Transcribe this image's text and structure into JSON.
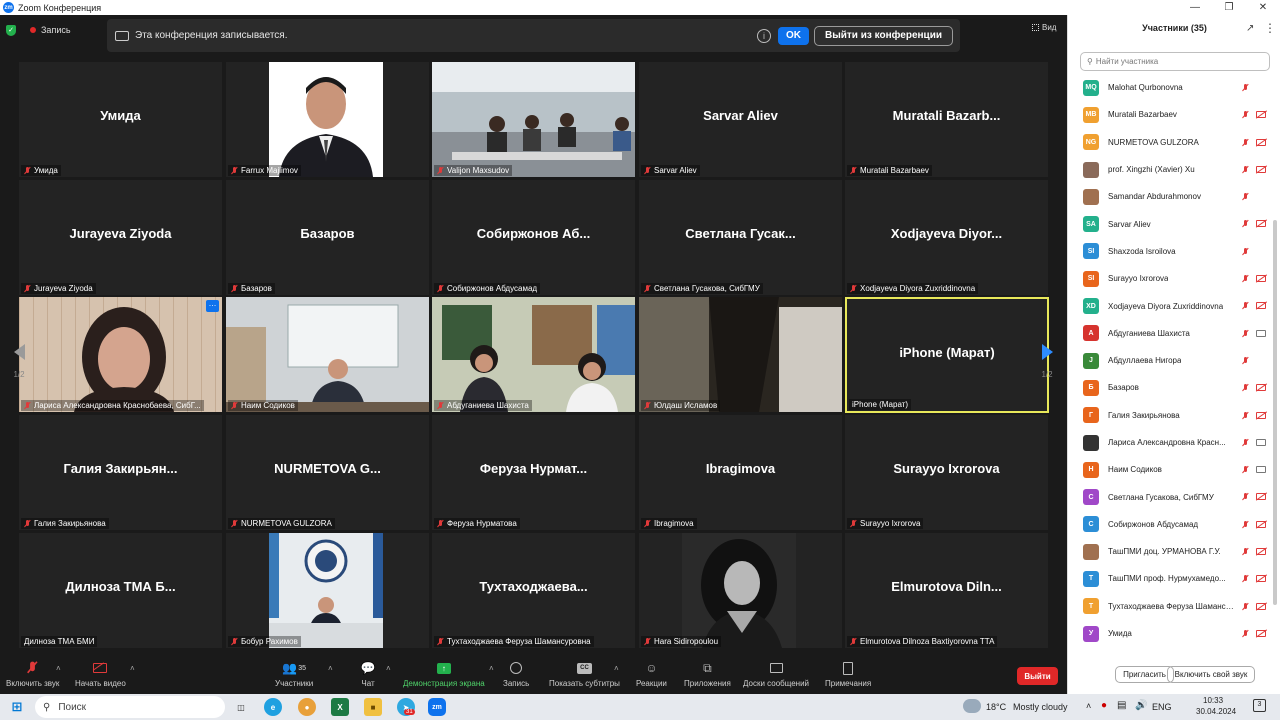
{
  "window": {
    "title": "Zoom Конференция"
  },
  "recording": {
    "label": "Запись"
  },
  "banner": {
    "text": "Эта конференция записывается.",
    "ok_label": "OK",
    "leave_label": "Выйти из конференции"
  },
  "view_label": "Вид",
  "page_indicator": "1/2",
  "tiles": [
    {
      "name": "Умида",
      "label": "Умида"
    },
    {
      "name": "",
      "label": "Farrux Majlimov"
    },
    {
      "name": "",
      "label": "Valijon Maxsudov"
    },
    {
      "name": "Sarvar Aliev",
      "label": "Sarvar Aliev"
    },
    {
      "name": "Muratali Bazarb...",
      "label": "Muratali Bazarbaev"
    },
    {
      "name": "Jurayeva Ziyoda",
      "label": "Jurayeva Ziyoda"
    },
    {
      "name": "Базаров",
      "label": "Базаров"
    },
    {
      "name": "Собиржонов Аб...",
      "label": "Собиржонов Абдусамад"
    },
    {
      "name": "Светлана Гусак...",
      "label": "Светлана Гусакова, СибГМУ"
    },
    {
      "name": "Xodjayeva Diyor...",
      "label": "Xodjayeva Diyora Zuxriddinovna"
    },
    {
      "name": "",
      "label": "Лариса Александровна Краснобаева, СибГ..."
    },
    {
      "name": "",
      "label": "Наим Содиков"
    },
    {
      "name": "",
      "label": "Абдуганиева Шахиста"
    },
    {
      "name": "",
      "label": "Юлдаш Исламов"
    },
    {
      "name": "iPhone (Марат)",
      "label": "iPhone (Марат)"
    },
    {
      "name": "Галия Закирьян...",
      "label": "Галия Закирьянова"
    },
    {
      "name": "NURMETOVA G...",
      "label": "NURMETOVA GULZORA"
    },
    {
      "name": "Феруза Нурмат...",
      "label": "Феруза Нурматова"
    },
    {
      "name": "Ibragimova",
      "label": "Ibragimova"
    },
    {
      "name": "Surayyo Ixrorova",
      "label": "Surayyo Ixrorova"
    },
    {
      "name": "Дилноза ТМА Б...",
      "label": "Дилноза ТМА БМИ"
    },
    {
      "name": "",
      "label": "Бобур Рахимов"
    },
    {
      "name": "Тухтаходжаева...",
      "label": "Тухтаходжаева Феруза Шамансуровна"
    },
    {
      "name": "",
      "label": "Hara Sidiropoulou"
    },
    {
      "name": "Elmurotova Diln...",
      "label": "Elmurotova Dilnoza Baxtiyorovna TTA"
    }
  ],
  "toolbar": {
    "mute": "Включить звук",
    "video": "Начать видео",
    "participants": "Участники",
    "participants_count": "35",
    "chat": "Чат",
    "share": "Демонстрация экрана",
    "record": "Запись",
    "captions": "Показать субтитры",
    "reactions": "Реакции",
    "apps": "Приложения",
    "whiteboards": "Доски сообщений",
    "notes": "Примечания",
    "leave": "Выйти"
  },
  "panel": {
    "title": "Участники (35)",
    "search_placeholder": "Найти участника",
    "invite": "Пригласить",
    "unmute_me": "Включить свой звук",
    "participants": [
      {
        "initials": "MQ",
        "name": "Malohat Qurbonovna",
        "color": "#23b08c",
        "cam": false
      },
      {
        "initials": "MB",
        "name": "Muratali Bazarbaev",
        "color": "#f0a030",
        "cam": true
      },
      {
        "initials": "NG",
        "name": "NURMETOVA GULZORA",
        "color": "#f0a030",
        "cam": true
      },
      {
        "initials": "",
        "name": "prof. Xingzhi (Xavier) Xu",
        "color": "#8a6a5a",
        "cam": true
      },
      {
        "initials": "",
        "name": "Samandar Abdurahmonov",
        "color": "#a07050",
        "cam": false
      },
      {
        "initials": "SA",
        "name": "Sarvar Aliev",
        "color": "#23b08c",
        "cam": true
      },
      {
        "initials": "SI",
        "name": "Shaxzoda Isroilova",
        "color": "#2c8ed6",
        "cam": false
      },
      {
        "initials": "SI",
        "name": "Surayyo Ixrorova",
        "color": "#e8651c",
        "cam": true
      },
      {
        "initials": "XD",
        "name": "Xodjayeva Diyora Zuxriddinovna",
        "color": "#23b08c",
        "cam": true
      },
      {
        "initials": "А",
        "name": "Абдуганиева Шахиста",
        "color": "#d6332e",
        "cam": true,
        "cam_on": true
      },
      {
        "initials": "J",
        "name": "Абдуллаева Нигора",
        "color": "#3a8a3a",
        "cam": false
      },
      {
        "initials": "Б",
        "name": "Базаров",
        "color": "#e8651c",
        "cam": true
      },
      {
        "initials": "Г",
        "name": "Галия Закирьянова",
        "color": "#e8651c",
        "cam": true
      },
      {
        "initials": "",
        "name": "Лариса Александровна Красн...",
        "color": "#333333",
        "cam": true,
        "cam_on": true
      },
      {
        "initials": "Н",
        "name": "Наим Содиков",
        "color": "#e8651c",
        "cam": true,
        "cam_on": true
      },
      {
        "initials": "С",
        "name": "Светлана Гусакова, СибГМУ",
        "color": "#a048c8",
        "cam": true
      },
      {
        "initials": "С",
        "name": "Собиржонов Абдусамад",
        "color": "#2c8ed6",
        "cam": true
      },
      {
        "initials": "",
        "name": "ТашПМИ доц. УРМАНОВА Г.У.",
        "color": "#a07050",
        "cam": true
      },
      {
        "initials": "Т",
        "name": "ТашПМИ проф. Нурмухамедо...",
        "color": "#2c8ed6",
        "cam": true
      },
      {
        "initials": "Т",
        "name": "Тухтаходжаева Феруза Шамансур...",
        "color": "#f0a030",
        "cam": true
      },
      {
        "initials": "У",
        "name": "Умида",
        "color": "#a048c8",
        "cam": true
      }
    ]
  },
  "taskbar": {
    "search": "Поиск",
    "weather_temp": "18°C",
    "weather_text": "Mostly cloudy",
    "lang": "ENG",
    "time": "10:33",
    "date": "30.04.2024",
    "notif_count": "3",
    "badge_31": "31"
  }
}
